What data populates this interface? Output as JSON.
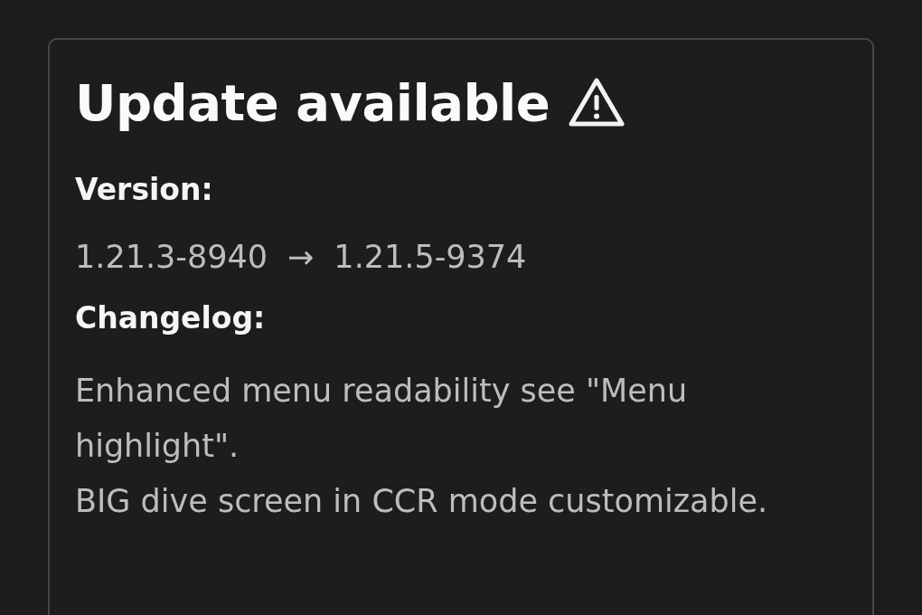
{
  "dialog": {
    "title": "Update available",
    "version_label": "Version:",
    "version": {
      "from": "1.21.3-8940",
      "arrow": "→",
      "to": "1.21.5-9374"
    },
    "changelog_label": "Changelog:",
    "changelog": [
      "Enhanced menu readability see \"Menu highlight\".",
      "BIG dive screen in CCR mode customizable."
    ]
  }
}
